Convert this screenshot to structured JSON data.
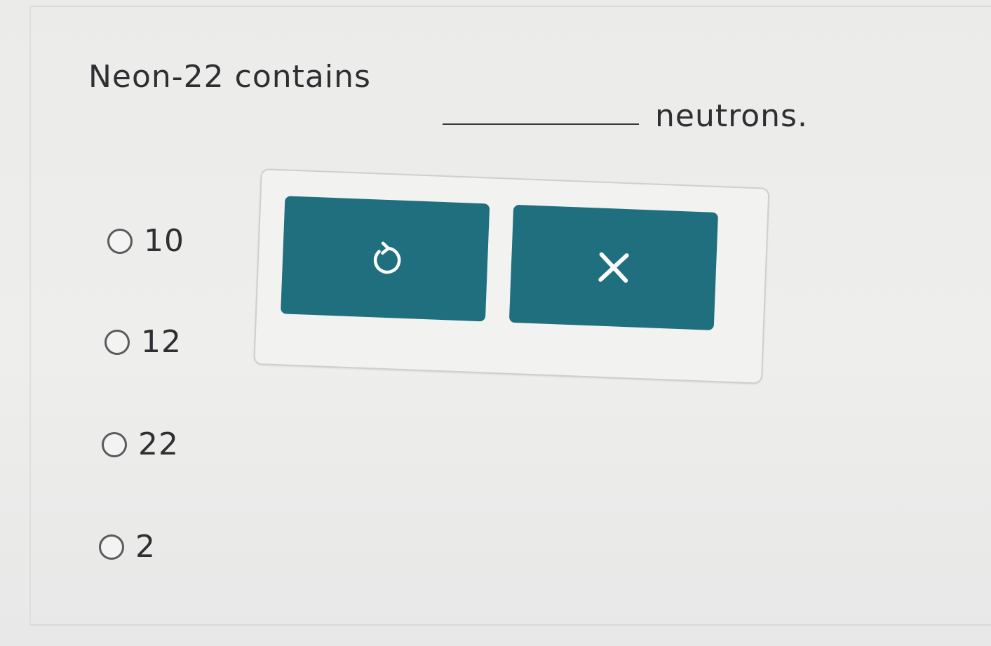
{
  "question": {
    "before_blank": "Neon-22 contains",
    "after_blank": "neutrons."
  },
  "choices": [
    {
      "label": "10"
    },
    {
      "label": "12"
    },
    {
      "label": "22"
    },
    {
      "label": "2"
    }
  ],
  "toolbox": {
    "reset_icon": "undo-icon",
    "clear_icon": "close-icon",
    "button_color": "#1f6f7e",
    "icon_color": "#ffffff"
  }
}
